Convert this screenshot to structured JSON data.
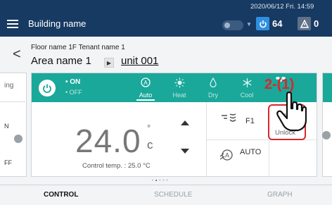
{
  "topbar": {
    "building_name": "Building name",
    "datetime": "2020/06/12 Fri. 14:59",
    "operating_count": "64",
    "warning_count": "0"
  },
  "header": {
    "floor_label": "Floor name 1F Tenant name 1",
    "area_name": "Area name 1",
    "unit_name": "unit 001"
  },
  "side_left": {
    "top_text": "ing",
    "mid_text": "N",
    "bottom_text": "FF"
  },
  "card": {
    "power": {
      "on_label": "• ON",
      "off_label": "• OFF"
    },
    "modes": [
      {
        "label": "Auto",
        "icon": "auto-mode-icon",
        "active": true
      },
      {
        "label": "Heat",
        "icon": "sun-icon",
        "active": false
      },
      {
        "label": "Dry",
        "icon": "droplet-icon",
        "active": false
      },
      {
        "label": "Cool",
        "icon": "snowflake-icon",
        "active": false
      }
    ],
    "temperature_value": "24.0",
    "temperature_degree": "°",
    "temperature_unit": "c",
    "control_temp_label": "Control temp. : 25.0 °C",
    "fan_speed": "F1",
    "airflow_label": "AUTO",
    "unlock_label": "Unlock"
  },
  "annotation": {
    "text": "2-(1)"
  },
  "tabs": [
    {
      "label": "CONTROL",
      "active": true
    },
    {
      "label": "SCHEDULE",
      "active": false
    },
    {
      "label": "GRAPH",
      "active": false
    }
  ],
  "colors": {
    "topbar": "#173a63",
    "mode_bar": "#1aa89a",
    "accent_red": "#d9262b",
    "badge_blue": "#2f8fe0"
  }
}
